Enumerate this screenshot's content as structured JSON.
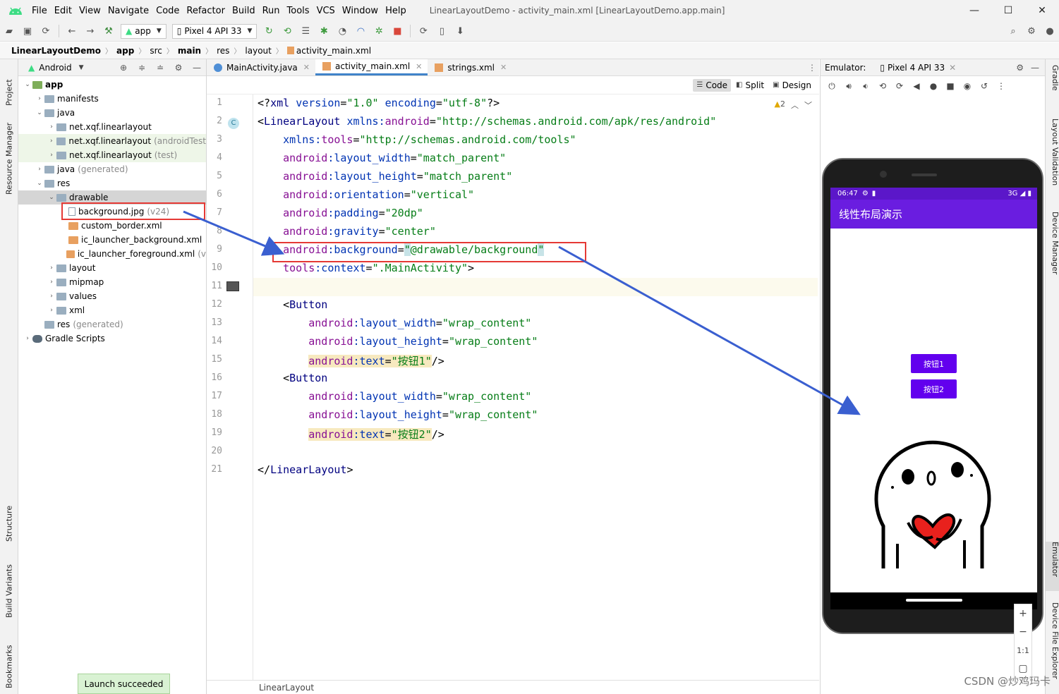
{
  "window": {
    "menus": [
      "File",
      "Edit",
      "View",
      "Navigate",
      "Code",
      "Refactor",
      "Build",
      "Run",
      "Tools",
      "VCS",
      "Window",
      "Help"
    ],
    "title": "LinearLayoutDemo - activity_main.xml [LinearLayoutDemo.app.main]",
    "minimize": "—",
    "maximize": "☐",
    "close": "✕"
  },
  "toolbar": {
    "run_config": "app",
    "device": "Pixel 4 API 33"
  },
  "breadcrumb": [
    "LinearLayoutDemo",
    "app",
    "src",
    "main",
    "res",
    "layout",
    "activity_main.xml"
  ],
  "left_strip": {
    "project": "Project",
    "resource_manager": "Resource Manager",
    "structure": "Structure",
    "build_variants": "Build Variants",
    "bookmarks": "Bookmarks"
  },
  "right_strip": {
    "gradle": "Gradle",
    "layout_validation": "Layout Validation",
    "device_manager": "Device Manager",
    "emulator": "Emulator",
    "device_file_explorer": "Device File Explorer"
  },
  "project_panel": {
    "view_mode": "Android",
    "tree": [
      {
        "label": "app",
        "extra": "",
        "depth": 0,
        "expanded": true,
        "icon": "folder-icon",
        "bold": true
      },
      {
        "label": "manifests",
        "extra": "",
        "depth": 1,
        "expanded": false,
        "icon": "folder-icon"
      },
      {
        "label": "java",
        "extra": "",
        "depth": 1,
        "expanded": true,
        "icon": "folder-icon"
      },
      {
        "label": "net.xqf.linearlayout",
        "extra": "",
        "depth": 2,
        "expanded": false,
        "icon": "package-icon"
      },
      {
        "label": "net.xqf.linearlayout",
        "extra": "(androidTest",
        "depth": 2,
        "expanded": false,
        "icon": "package-icon"
      },
      {
        "label": "net.xqf.linearlayout",
        "extra": "(test)",
        "depth": 2,
        "expanded": false,
        "icon": "package-icon"
      },
      {
        "label": "java",
        "extra": "(generated)",
        "depth": 1,
        "expanded": false,
        "icon": "folder-icon"
      },
      {
        "label": "res",
        "extra": "",
        "depth": 1,
        "expanded": true,
        "icon": "folder-icon"
      },
      {
        "label": "drawable",
        "extra": "",
        "depth": 2,
        "expanded": true,
        "icon": "folder-icon"
      },
      {
        "label": "background.jpg",
        "extra": "(v24)",
        "depth": 3,
        "expanded": null,
        "icon": "image-file-icon"
      },
      {
        "label": "custom_border.xml",
        "extra": "",
        "depth": 3,
        "expanded": null,
        "icon": "xml-file-icon"
      },
      {
        "label": "ic_launcher_background.xml",
        "extra": "",
        "depth": 3,
        "expanded": null,
        "icon": "xml-file-icon"
      },
      {
        "label": "ic_launcher_foreground.xml",
        "extra": "(v",
        "depth": 3,
        "expanded": null,
        "icon": "xml-file-icon"
      },
      {
        "label": "layout",
        "extra": "",
        "depth": 2,
        "expanded": false,
        "icon": "folder-icon"
      },
      {
        "label": "mipmap",
        "extra": "",
        "depth": 2,
        "expanded": false,
        "icon": "folder-icon"
      },
      {
        "label": "values",
        "extra": "",
        "depth": 2,
        "expanded": false,
        "icon": "folder-icon"
      },
      {
        "label": "xml",
        "extra": "",
        "depth": 2,
        "expanded": false,
        "icon": "folder-icon"
      },
      {
        "label": "res",
        "extra": "(generated)",
        "depth": 1,
        "expanded": null,
        "icon": "folder-icon"
      },
      {
        "label": "Gradle Scripts",
        "extra": "",
        "depth": 0,
        "expanded": false,
        "icon": "gradle-icon"
      }
    ]
  },
  "toast": "Launch succeeded",
  "editor": {
    "tabs": [
      {
        "label": "MainActivity.java",
        "active": false
      },
      {
        "label": "activity_main.xml",
        "active": true
      },
      {
        "label": "strings.xml",
        "active": false
      }
    ],
    "view_modes": [
      "Code",
      "Split",
      "Design"
    ],
    "warnings": "2",
    "status": "LinearLayout",
    "line_numbers": [
      "1",
      "2",
      "3",
      "4",
      "5",
      "6",
      "7",
      "8",
      "9",
      "10",
      "11",
      "12",
      "13",
      "14",
      "15",
      "16",
      "17",
      "18",
      "19",
      "20",
      "21"
    ],
    "lines": [
      [
        [
          "t-pun",
          "<?"
        ],
        [
          "t-tag",
          "xml "
        ],
        [
          "t-ns",
          "version"
        ],
        [
          "t-pun",
          "="
        ],
        [
          "t-val",
          "\"1.0\" "
        ],
        [
          "t-ns",
          "encoding"
        ],
        [
          "t-pun",
          "="
        ],
        [
          "t-val",
          "\"utf-8\""
        ],
        [
          "t-pun",
          "?>"
        ]
      ],
      [
        [
          "t-pun",
          "<"
        ],
        [
          "t-tag",
          "LinearLayout "
        ],
        [
          "t-ns",
          "xmlns:"
        ],
        [
          "t-attr",
          "android"
        ],
        [
          "t-pun",
          "="
        ],
        [
          "t-val",
          "\"http://schemas.android.com/apk/res/android\""
        ]
      ],
      [
        [
          "t-pun",
          "    "
        ],
        [
          "t-ns",
          "xmlns:"
        ],
        [
          "t-attr",
          "tools"
        ],
        [
          "t-pun",
          "="
        ],
        [
          "t-val",
          "\"http://schemas.android.com/tools\""
        ]
      ],
      [
        [
          "t-pun",
          "    "
        ],
        [
          "t-attr",
          "android"
        ],
        [
          "t-ns",
          ":layout_width"
        ],
        [
          "t-pun",
          "="
        ],
        [
          "t-val",
          "\"match_parent\""
        ]
      ],
      [
        [
          "t-pun",
          "    "
        ],
        [
          "t-attr",
          "android"
        ],
        [
          "t-ns",
          ":layout_height"
        ],
        [
          "t-pun",
          "="
        ],
        [
          "t-val",
          "\"match_parent\""
        ]
      ],
      [
        [
          "t-pun",
          "    "
        ],
        [
          "t-attr",
          "android"
        ],
        [
          "t-ns",
          ":orientation"
        ],
        [
          "t-pun",
          "="
        ],
        [
          "t-val",
          "\"vertical\""
        ]
      ],
      [
        [
          "t-pun",
          "    "
        ],
        [
          "t-attr",
          "android"
        ],
        [
          "t-ns",
          ":padding"
        ],
        [
          "t-pun",
          "="
        ],
        [
          "t-val",
          "\"20dp\""
        ]
      ],
      [
        [
          "t-pun",
          "    "
        ],
        [
          "t-attr",
          "android"
        ],
        [
          "t-ns",
          ":gravity"
        ],
        [
          "t-pun",
          "="
        ],
        [
          "t-val",
          "\"center\""
        ]
      ],
      [
        [
          "t-pun",
          "    "
        ],
        [
          "t-attr",
          "android"
        ],
        [
          "t-ns",
          ":background"
        ],
        [
          "t-pun",
          "="
        ],
        [
          "t-val hl-sel",
          "\""
        ],
        [
          "t-val",
          "@drawable/background"
        ],
        [
          "t-val hl-sel",
          "\""
        ]
      ],
      [
        [
          "t-pun",
          "    "
        ],
        [
          "t-attr",
          "tools"
        ],
        [
          "t-ns",
          ":context"
        ],
        [
          "t-pun",
          "="
        ],
        [
          "t-val",
          "\".MainActivity\""
        ],
        [
          "t-pun",
          ">"
        ]
      ],
      [],
      [
        [
          "t-pun",
          "    <"
        ],
        [
          "t-tag",
          "Button"
        ]
      ],
      [
        [
          "t-pun",
          "        "
        ],
        [
          "t-attr",
          "android"
        ],
        [
          "t-ns",
          ":layout_width"
        ],
        [
          "t-pun",
          "="
        ],
        [
          "t-val",
          "\"wrap_content\""
        ]
      ],
      [
        [
          "t-pun",
          "        "
        ],
        [
          "t-attr",
          "android"
        ],
        [
          "t-ns",
          ":layout_height"
        ],
        [
          "t-pun",
          "="
        ],
        [
          "t-val",
          "\"wrap_content\""
        ]
      ],
      [
        [
          "t-pun",
          "        "
        ],
        [
          "t-attr hl-text",
          "android"
        ],
        [
          "t-ns hl-text",
          ":text"
        ],
        [
          "t-pun hl-text",
          "="
        ],
        [
          "t-val hl-text",
          "\"按钮1\""
        ],
        [
          "t-pun",
          "/>"
        ]
      ],
      [
        [
          "t-pun",
          "    <"
        ],
        [
          "t-tag",
          "Button"
        ]
      ],
      [
        [
          "t-pun",
          "        "
        ],
        [
          "t-attr",
          "android"
        ],
        [
          "t-ns",
          ":layout_width"
        ],
        [
          "t-pun",
          "="
        ],
        [
          "t-val",
          "\"wrap_content\""
        ]
      ],
      [
        [
          "t-pun",
          "        "
        ],
        [
          "t-attr",
          "android"
        ],
        [
          "t-ns",
          ":layout_height"
        ],
        [
          "t-pun",
          "="
        ],
        [
          "t-val",
          "\"wrap_content\""
        ]
      ],
      [
        [
          "t-pun",
          "        "
        ],
        [
          "t-attr hl-text",
          "android"
        ],
        [
          "t-ns hl-text",
          ":text"
        ],
        [
          "t-pun hl-text",
          "="
        ],
        [
          "t-val hl-text",
          "\"按钮2\""
        ],
        [
          "t-pun",
          "/>"
        ]
      ],
      [],
      [
        [
          "t-pun",
          "</"
        ],
        [
          "t-tag",
          "LinearLayout"
        ],
        [
          "t-pun",
          ">"
        ]
      ]
    ]
  },
  "emulator": {
    "label": "Emulator:",
    "device_tab": "Pixel 4 API 33",
    "phone": {
      "time": "06:47",
      "signal": "3G",
      "app_title": "线性布局演示",
      "button1": "按钮1",
      "button2": "按钮2"
    },
    "zoom": {
      "in": "+",
      "out": "−",
      "actual": "1:1"
    }
  },
  "watermark": "CSDN @炒鸡玛卡"
}
